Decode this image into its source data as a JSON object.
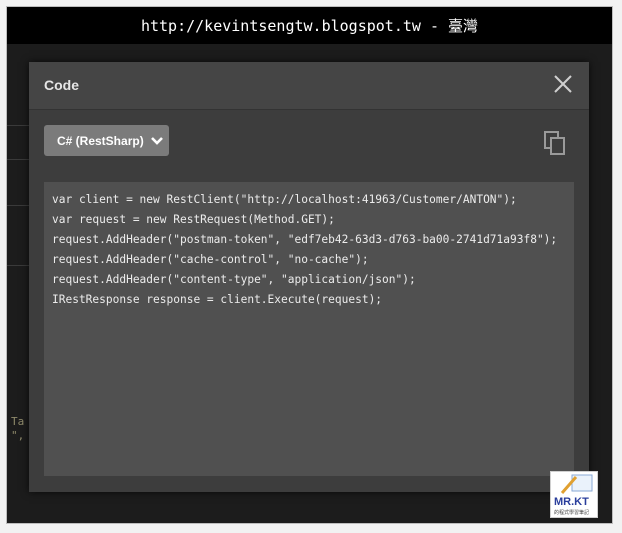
{
  "banner": {
    "text": "http://kevintsengtw.blogspot.tw - 臺灣"
  },
  "background": {
    "fragment_1": "Ta",
    "fragment_2": "\","
  },
  "modal": {
    "title": "Code",
    "language": "C# (RestSharp)",
    "code_lines": [
      "var client = new RestClient(\"http://localhost:41963/Customer/ANTON\");",
      "var request = new RestRequest(Method.GET);",
      "request.AddHeader(\"postman-token\", \"edf7eb42-63d3-d763-ba00-2741d71a93f8\");",
      "request.AddHeader(\"cache-control\", \"no-cache\");",
      "request.AddHeader(\"content-type\", \"application/json\");",
      "IRestResponse response = client.Execute(request);"
    ]
  },
  "logo": {
    "text": "MR.KT",
    "subtext": "的程式學習筆記"
  },
  "icons": {
    "close": "close-icon",
    "dropdown": "chevron-down-icon",
    "copy": "copy-icon"
  }
}
